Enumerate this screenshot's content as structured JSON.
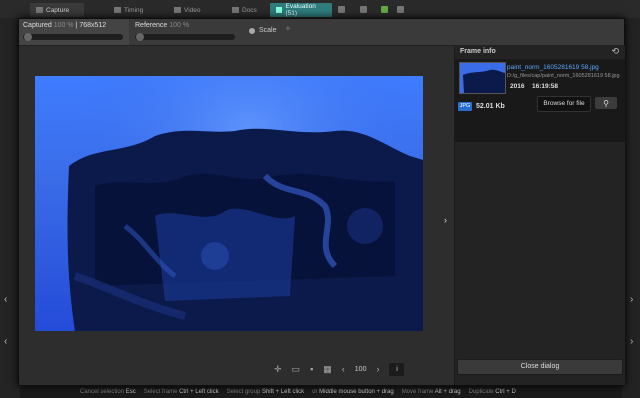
{
  "app_tabs": [
    {
      "label": "Capture",
      "icon": "camera-icon"
    },
    {
      "label": "Timing",
      "icon": "timing-icon"
    },
    {
      "label": "Video",
      "icon": "video-icon"
    },
    {
      "label": "Docs",
      "icon": "docs-icon"
    },
    {
      "label": "Evaluation (51)",
      "icon": "evaluation-icon"
    }
  ],
  "toolbar": {
    "captured_label": "Captured",
    "captured_pct": "100 %",
    "captured_res": "| 768x512",
    "reference_label": "Reference",
    "reference_pct": "100 %",
    "scale_label": "Scale"
  },
  "viewer": {
    "zoom_value": "100"
  },
  "frame_info": {
    "title": "Frame info",
    "file_name": "paint_norm_1605281619 58.jpg",
    "file_path": "D:/g_files/cap/paint_norm_1605281619 58.jpg",
    "date": "2016",
    "time": "16:19:58",
    "format_badge": "JPG",
    "file_size": "52.01 Kb",
    "browse_tooltip": "Browse for file",
    "close_label": "Close dialog"
  },
  "bg_hints": [
    {
      "label": "Cancel selection",
      "key": "Esc"
    },
    {
      "label": "Select frame",
      "key": "Ctrl + Left click"
    },
    {
      "label": "Select group",
      "key": "Shift + Left click"
    },
    {
      "label": "or",
      "key": "Middle mouse button + drag"
    },
    {
      "label": "Move frame",
      "key": "Alt + drag"
    },
    {
      "label": "Duplicate",
      "key": "Ctrl + D"
    }
  ],
  "colors": {
    "accent_teal": "#2f7c7c",
    "link_blue": "#5aa9ff",
    "badge_blue": "#2a6fd0"
  }
}
